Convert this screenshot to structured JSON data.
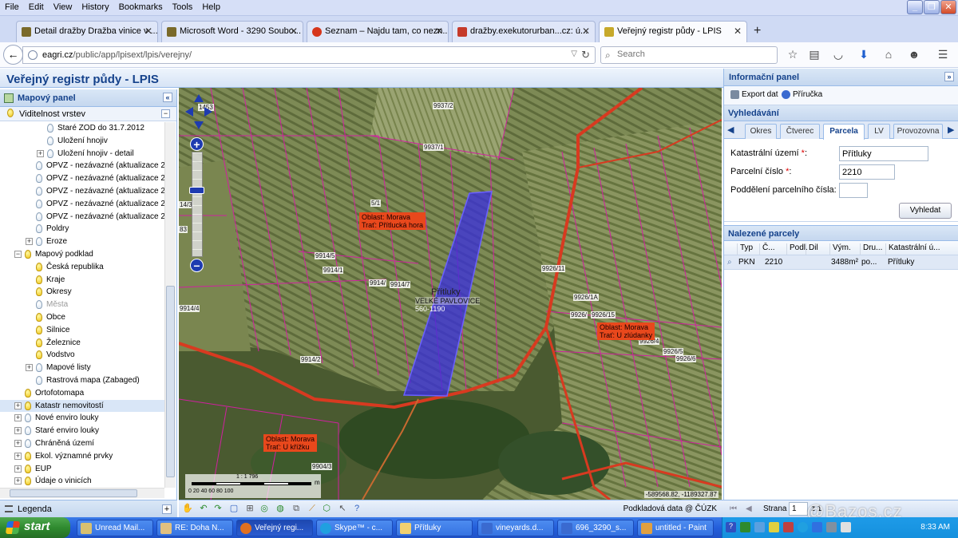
{
  "menu": [
    "File",
    "Edit",
    "View",
    "History",
    "Bookmarks",
    "Tools",
    "Help"
  ],
  "tabs": [
    {
      "label": "Detail dražby Dražba vinice v ...",
      "icon_color": "#7a6a2a"
    },
    {
      "label": "Microsoft Word - 3290 Soubo...",
      "icon_color": "#7a6a2a"
    },
    {
      "label": "Seznam – Najdu tam, co nezn...",
      "icon_color": "#d6361b"
    },
    {
      "label": "dražby.exekutorurban...cz: ú...",
      "icon_color": "#c53a2a"
    },
    {
      "label": "Veřejný registr půdy - LPIS",
      "icon_color": "#c7a92a"
    }
  ],
  "nav": {
    "url_host": "eagri.cz",
    "url_path": "/public/app/lpisext/lpis/verejny/",
    "search_placeholder": "Search"
  },
  "app": {
    "title": "Veřejný registr půdy - ",
    "title_brand": "LPIS"
  },
  "left_panel": {
    "title": "Mapový panel",
    "sub": "Viditelnost vrstev",
    "tree": [
      {
        "label": "Staré ZOD do 31.7.2012",
        "indent": 72,
        "pm": "",
        "bulb": "off"
      },
      {
        "label": "Uložení hnojiv",
        "indent": 72,
        "pm": "",
        "bulb": "off"
      },
      {
        "label": "Uložení hnojiv - detail",
        "indent": 72,
        "pm": "+",
        "bulb": "off"
      },
      {
        "label": "OPVZ - nezávazné (aktualizace 20",
        "indent": 58,
        "pm": "",
        "bulb": "off"
      },
      {
        "label": "OPVZ - nezávazné (aktualizace 20",
        "indent": 58,
        "pm": "",
        "bulb": "off"
      },
      {
        "label": "OPVZ - nezávazné (aktualizace 20",
        "indent": 58,
        "pm": "",
        "bulb": "off"
      },
      {
        "label": "OPVZ - nezávazné (aktualizace 20",
        "indent": 58,
        "pm": "",
        "bulb": "off"
      },
      {
        "label": "OPVZ - nezávazné (aktualizace 20",
        "indent": 58,
        "pm": "",
        "bulb": "off"
      },
      {
        "label": "Poldry",
        "indent": 58,
        "pm": "",
        "bulb": "off"
      },
      {
        "label": "Eroze",
        "indent": 58,
        "pm": "+",
        "bulb": "off"
      },
      {
        "label": "Mapový podklad",
        "indent": 44,
        "pm": "-",
        "bulb": "on"
      },
      {
        "label": "Česká republika",
        "indent": 58,
        "pm": "",
        "bulb": "on"
      },
      {
        "label": "Kraje",
        "indent": 58,
        "pm": "",
        "bulb": "on"
      },
      {
        "label": "Okresy",
        "indent": 58,
        "pm": "",
        "bulb": "on"
      },
      {
        "label": "Města",
        "indent": 58,
        "pm": "",
        "bulb": "off",
        "gray": true
      },
      {
        "label": "Obce",
        "indent": 58,
        "pm": "",
        "bulb": "on"
      },
      {
        "label": "Silnice",
        "indent": 58,
        "pm": "",
        "bulb": "on"
      },
      {
        "label": "Železnice",
        "indent": 58,
        "pm": "",
        "bulb": "on"
      },
      {
        "label": "Vodstvo",
        "indent": 58,
        "pm": "",
        "bulb": "on"
      },
      {
        "label": "Mapové listy",
        "indent": 58,
        "pm": "+",
        "bulb": "off"
      },
      {
        "label": "Rastrová mapa (Zabaged)",
        "indent": 58,
        "pm": "",
        "bulb": "off"
      },
      {
        "label": "Ortofotomapa",
        "indent": 44,
        "pm": "",
        "bulb": "on"
      },
      {
        "label": "Katastr nemovitostí",
        "indent": 44,
        "pm": "+",
        "bulb": "on",
        "selected": true
      },
      {
        "label": "Nové enviro louky",
        "indent": 44,
        "pm": "+",
        "bulb": "off"
      },
      {
        "label": "Staré enviro louky",
        "indent": 44,
        "pm": "+",
        "bulb": "off"
      },
      {
        "label": "Chráněná území",
        "indent": 44,
        "pm": "+",
        "bulb": "off"
      },
      {
        "label": "Ekol. významné prvky",
        "indent": 44,
        "pm": "+",
        "bulb": "on"
      },
      {
        "label": "EUP",
        "indent": 44,
        "pm": "+",
        "bulb": "on"
      },
      {
        "label": "Údaje o vinicích",
        "indent": 44,
        "pm": "+",
        "bulb": "on"
      }
    ],
    "legend": "Legenda"
  },
  "map": {
    "parcel_labels": [
      "9937/2",
      "9937/1",
      "9914/5",
      "9914/7",
      "9914/",
      "9914/4",
      "9914/2",
      "9926/11",
      "9926/1A",
      "9926/15",
      "9926/4",
      "9926/5",
      "9926/6",
      "9904/3",
      "14/3",
      "1453",
      "83",
      "9914/1",
      "5/1",
      "9926/"
    ],
    "orange_labels": [
      {
        "line1": "Oblast: Morava",
        "line2": "Trať: Přítlucká hora"
      },
      {
        "line1": "Oblast: Morava",
        "line2": "Trať: U zlúdanky"
      },
      {
        "line1": "Oblast: Morava",
        "line2": "Trať: U křížku"
      }
    ],
    "center_label_top": "Přítluky",
    "center_label_mid": "VELKÉ PAVLOVICE",
    "center_label_bot": "560-1190",
    "scale_label": "1 : 1 796",
    "scale_nums": "0    20    40    60    80    100",
    "scale_unit": "m",
    "coords": "-589568.82, -1189327.87",
    "attribution": "Podkladová data @ ČÚZK"
  },
  "right_panel": {
    "title": "Informační panel",
    "export": "Export dat",
    "help": "Příručka",
    "search_title": "Vyhledávání",
    "search_tabs": [
      "Okres",
      "Čtverec",
      "Parcela",
      "LV",
      "Provozovna"
    ],
    "active_tab": "Parcela",
    "fields": [
      {
        "label": "Katastrální území",
        "required": true,
        "value": "Přítluky"
      },
      {
        "label": "Parcelní číslo",
        "required": true,
        "value": "2210"
      },
      {
        "label": "Poddělení parcelního čísla",
        "required": false,
        "value": ""
      }
    ],
    "search_button": "Vyhledat",
    "results_title": "Nalezené parcely",
    "columns": [
      "Typ",
      "Č...",
      "Podl.",
      "Dil",
      "Vým.",
      "Dru...",
      "Katastrální ú..."
    ],
    "rows": [
      {
        "typ": "PKN",
        "cislo": "2210",
        "podl": "",
        "dil": "",
        "vym": "3488m²",
        "druh": "po...",
        "ku": "Přítluky"
      }
    ],
    "pager_label": "Strana",
    "pager_value": "1",
    "pager_of": "z 1"
  },
  "taskbar": {
    "start": "start",
    "tasks": [
      {
        "label": "Unread Mail...",
        "icon_color": "#d8c070"
      },
      {
        "label": "RE: Doha N...",
        "icon_color": "#e0c080"
      },
      {
        "label": "Veřejný regi...",
        "icon_color": "#e07020"
      },
      {
        "label": "Skype™ - c...",
        "icon_color": "#20a0e0"
      },
      {
        "label": "Přítluky",
        "icon_color": "#f0d070"
      },
      {
        "label": "vineyards.d...",
        "icon_color": "#3a6ad0"
      },
      {
        "label": "696_3290_s...",
        "icon_color": "#3a6ad0"
      },
      {
        "label": "untitled - Paint",
        "icon_color": "#e0a040"
      }
    ],
    "clock": "8:33 AM"
  },
  "watermark": "@Bazos.cz"
}
